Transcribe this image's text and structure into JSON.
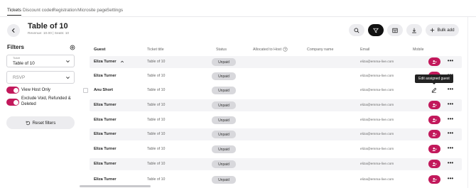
{
  "nav": {
    "tabs": [
      "Tickets",
      "Discount codes",
      "Registration",
      "Microsite page",
      "Settings"
    ]
  },
  "header": {
    "title": "Table of 10",
    "subtitle": "Revenue: 10.00  |  Seats: 10",
    "bulk_add_label": "Bulk add"
  },
  "filters": {
    "title": "Filters",
    "ticket_label": "Ticket",
    "ticket_value": "Table of 10",
    "rsvp_placeholder": "RSVP",
    "toggle_view_host_only": "View Host Only",
    "toggle_exclude": "Exclude Void, Refunded & Deleted",
    "reset_label": "Reset filters"
  },
  "table": {
    "columns": {
      "guest": "Guest",
      "ticket_title": "Ticket title",
      "status": "Status",
      "allocated_to_host": "Allocated to Host",
      "company_name": "Company name",
      "email": "Email",
      "mobile": "Mobile"
    },
    "rows": [
      {
        "guest": "Eliza Turner",
        "ticket": "Table of 10",
        "status": "Unpaid",
        "email": "eliza@emma-live.com",
        "action": "add"
      },
      {
        "guest": "Eliza Turner",
        "ticket": "Table of 10",
        "status": "Unpaid",
        "email": "eliza@emma-live.com",
        "action": "add"
      },
      {
        "guest": "Anu Short",
        "ticket": "Table of 10",
        "status": "Unpaid",
        "email": "eliza@emma-live.com",
        "action": "edit"
      },
      {
        "guest": "Eliza Turner",
        "ticket": "Table of 10",
        "status": "Unpaid",
        "email": "eliza@emma-live.com",
        "action": "add"
      },
      {
        "guest": "Eliza Turner",
        "ticket": "Table of 10",
        "status": "Unpaid",
        "email": "eliza@emma-live.com",
        "action": "add"
      },
      {
        "guest": "Eliza Turner",
        "ticket": "Table of 10",
        "status": "Unpaid",
        "email": "eliza@emma-live.com",
        "action": "add"
      },
      {
        "guest": "Eliza Turner",
        "ticket": "Table of 10",
        "status": "Unpaid",
        "email": "eliza@emma-live.com",
        "action": "add"
      },
      {
        "guest": "Eliza Turner",
        "ticket": "Table of 10",
        "status": "Unpaid",
        "email": "eliza@emma-live.com",
        "action": "add"
      },
      {
        "guest": "Eliza Turner",
        "ticket": "Table of 10",
        "status": "Unpaid",
        "email": "eliza@emma-live.com",
        "action": "add"
      }
    ]
  },
  "tooltip": "Edit assigned guest",
  "colors": {
    "accent": "#c2185b",
    "pill": "#ececef",
    "row_alt": "#f4f4f6"
  }
}
